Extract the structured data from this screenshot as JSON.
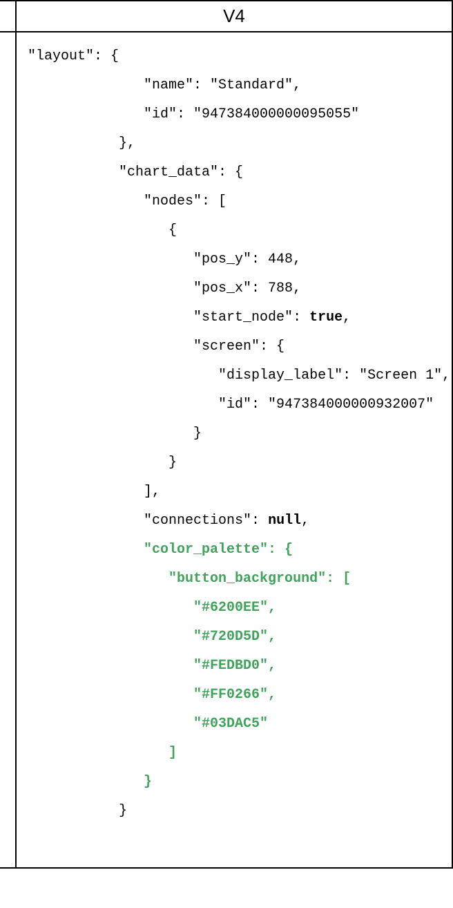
{
  "header": {
    "title": "V4"
  },
  "code": {
    "line1": "\"layout\": {",
    "line2": "              \"name\": \"Standard\",",
    "line3": "              \"id\": \"947384000000095055\"",
    "line4": "           },",
    "line5": "           \"chart_data\": {",
    "line6": "              \"nodes\": [",
    "line7": "                 {",
    "line8": "                    \"pos_y\": 448,",
    "line9": "                    \"pos_x\": 788,",
    "line10a": "                    \"start_node\": ",
    "line10b": "true",
    "line10c": ",",
    "line11": "                    \"screen\": {",
    "line12": "                       \"display_label\": \"Screen 1\",",
    "line13": "                       \"id\": \"947384000000932007\"",
    "line14": "                    }",
    "line15": "                 }",
    "line16": "              ],",
    "line17a": "              \"connections\": ",
    "line17b": "null",
    "line17c": ",",
    "line18": "              \"color_palette\": {",
    "line19": "                 \"button_background\": [",
    "line20": "                    \"#6200EE\",",
    "line21": "                    \"#720D5D\",",
    "line22": "                    \"#FEDBD0\",",
    "line23": "                    \"#FF0266\",",
    "line24": "                    \"#03DAC5\"",
    "line25": "                 ]",
    "line26": "              }",
    "line27": "           }"
  }
}
